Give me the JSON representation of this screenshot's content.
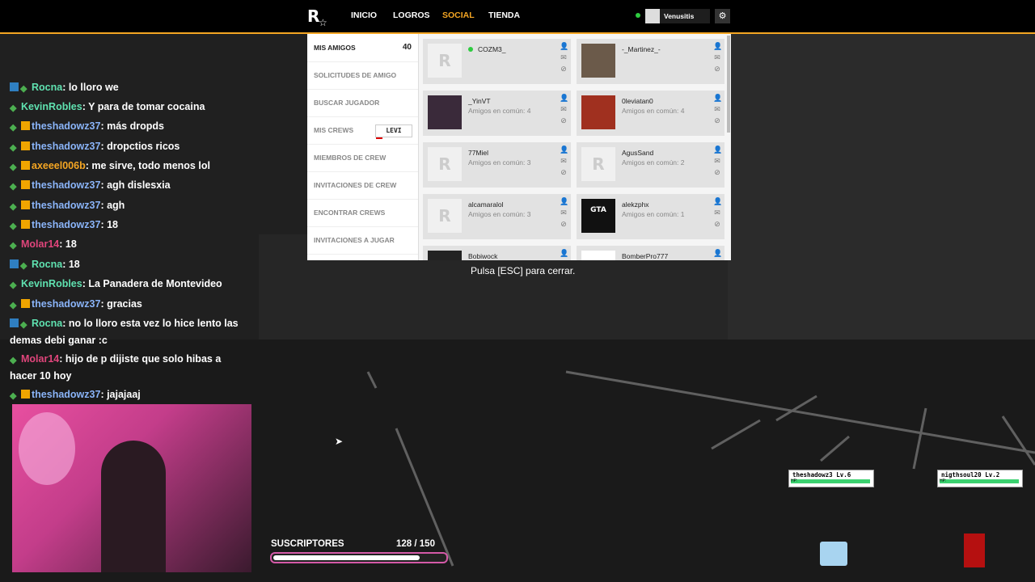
{
  "nav": {
    "tabs": [
      {
        "label": "INICIO"
      },
      {
        "label": "LOGROS"
      },
      {
        "label": "SOCIAL"
      },
      {
        "label": "TIENDA"
      }
    ],
    "active_tab": "SOCIAL",
    "username": "Venusitis",
    "accent_color": "#f5a623"
  },
  "social": {
    "sidebar": [
      {
        "label": "MIS AMIGOS",
        "count": "40"
      },
      {
        "label": "SOLICITUDES DE AMIGO"
      },
      {
        "label": "BUSCAR JUGADOR"
      },
      {
        "label": "MIS CREWS",
        "tag": "LEVI"
      },
      {
        "label": "MIEMBROS DE CREW"
      },
      {
        "label": "INVITACIONES DE CREW"
      },
      {
        "label": "ENCONTRAR CREWS"
      },
      {
        "label": "INVITACIONES A JUGAR"
      }
    ],
    "friends": [
      {
        "name": "COZM3_",
        "common": ""
      },
      {
        "name": "-_Martinez_-",
        "common": ""
      },
      {
        "name": "_YinVT",
        "common": "Amigos en común: 4"
      },
      {
        "name": "0leviatan0",
        "common": "Amigos en común: 4"
      },
      {
        "name": "77Miel",
        "common": "Amigos en común: 3"
      },
      {
        "name": "AgusSand",
        "common": "Amigos en común: 2"
      },
      {
        "name": "alcamaralol",
        "common": "Amigos en común: 3"
      },
      {
        "name": "alekzphx",
        "common": "Amigos en común: 1"
      },
      {
        "name": "Bobiwock",
        "common": ""
      },
      {
        "name": "BomberPro777",
        "common": ""
      }
    ],
    "esc_hint": "Pulsa [ESC] para cerrar."
  },
  "chat": [
    {
      "user": "Rocna",
      "text": ": lo lloro we",
      "color": "#5fe2b0",
      "badges": [
        "prime",
        "diamond"
      ]
    },
    {
      "user": "KevinRobles",
      "text": ": Y para de tomar cocaina",
      "color": "#5fe2b0",
      "badges": [
        "diamond"
      ]
    },
    {
      "user": "theshadowz37",
      "text": ": más dropds",
      "color": "#8ab4f8",
      "badges": [
        "diamond",
        "sub"
      ]
    },
    {
      "user": "theshadowz37",
      "text": ": dropctios ricos",
      "color": "#8ab4f8",
      "badges": [
        "diamond",
        "sub"
      ]
    },
    {
      "user": "axeeel006b",
      "text": ": me sirve, todo menos lol",
      "color": "#f5a623",
      "badges": [
        "diamond",
        "sub"
      ]
    },
    {
      "user": "theshadowz37",
      "text": ": agh dislesxia",
      "color": "#8ab4f8",
      "badges": [
        "diamond",
        "sub"
      ]
    },
    {
      "user": "theshadowz37",
      "text": ": agh",
      "color": "#8ab4f8",
      "badges": [
        "diamond",
        "sub"
      ]
    },
    {
      "user": "theshadowz37",
      "text": ": 18",
      "color": "#8ab4f8",
      "badges": [
        "diamond",
        "sub"
      ]
    },
    {
      "user": "Molar14",
      "text": ": 18",
      "color": "#e0457b",
      "badges": [
        "diamond"
      ]
    },
    {
      "user": "Rocna",
      "text": ": 18",
      "color": "#5fe2b0",
      "badges": [
        "prime",
        "diamond"
      ]
    },
    {
      "user": "KevinRobles",
      "text": ": La Panadera de Montevideo",
      "color": "#5fe2b0",
      "badges": [
        "diamond"
      ]
    },
    {
      "user": "theshadowz37",
      "text": ": gracias",
      "color": "#8ab4f8",
      "badges": [
        "diamond",
        "sub"
      ]
    },
    {
      "user": "Rocna",
      "text": ": no lo lloro esta vez lo hice lento las demas debi ganar :c",
      "color": "#5fe2b0",
      "badges": [
        "prime",
        "diamond"
      ]
    },
    {
      "user": "Molar14",
      "text": ": hijo de p dijiste que solo hibas a hacer 10 hoy",
      "color": "#e0457b",
      "badges": [
        "diamond"
      ]
    },
    {
      "user": "theshadowz37",
      "text": ": jajajaaj",
      "color": "#8ab4f8",
      "badges": [
        "diamond",
        "sub"
      ]
    }
  ],
  "subs": {
    "title": "SUSCRIPTORES",
    "count": "128 / 150",
    "current": 128,
    "goal": 150
  },
  "players": [
    {
      "name": "theshadowz3",
      "level": "Lv.6",
      "hp": "HP:"
    },
    {
      "name": "nigthsoul20",
      "level": "Lv.2",
      "hp": "HP:"
    }
  ]
}
